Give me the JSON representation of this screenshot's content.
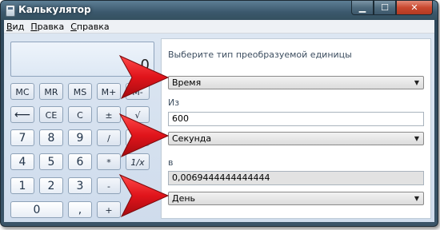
{
  "window": {
    "title": "Калькулятор",
    "controls": {
      "minimize": "▁",
      "maximize": "☐",
      "close": "✕"
    }
  },
  "menu": [
    {
      "label": "Вид"
    },
    {
      "label": "Правка"
    },
    {
      "label": "Справка"
    }
  ],
  "display": {
    "value": "0"
  },
  "keys": {
    "mc": "MC",
    "mr": "MR",
    "ms": "MS",
    "mplus": "M+",
    "mminus": "M-",
    "backspace": "⟵",
    "ce": "CE",
    "c": "C",
    "plusminus": "±",
    "sqrt": "√",
    "n7": "7",
    "n8": "8",
    "n9": "9",
    "divide": "/",
    "percent": "%",
    "n4": "4",
    "n5": "5",
    "n6": "6",
    "multiply": "*",
    "reciprocal": "1/x",
    "n1": "1",
    "n2": "2",
    "n3": "3",
    "minus": "-",
    "n0": "0",
    "dot": ",",
    "plus": "+"
  },
  "converter": {
    "heading": "Выберите тип преобразуемой единицы",
    "unit_type": "Время",
    "from_label": "Из",
    "from_value": "600",
    "from_unit": "Секунда",
    "to_label": "в",
    "to_value": "0,0069444444444444",
    "to_unit": "День"
  },
  "annotation_color": "#e0141b"
}
